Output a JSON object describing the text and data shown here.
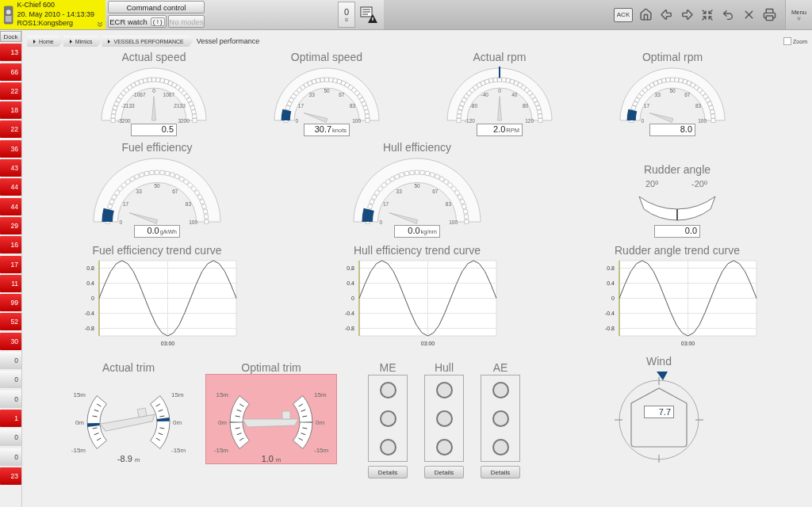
{
  "header": {
    "title": "K-Chief 600",
    "datetime": "20. May 2010 - 14:13:39",
    "location": "ROS1:Kongsberg"
  },
  "command_button": {
    "label": "Command control"
  },
  "watch_button": {
    "label": "ECR watch",
    "badge": "( ! )"
  },
  "modes_button": {
    "label": "No modes",
    "disabled": true
  },
  "alarm_counter": "0",
  "toolbar": {
    "ack": "ACK",
    "menu": "Menu"
  },
  "dock": {
    "label": "Dock",
    "items": [
      {
        "count": "13",
        "alarm": true
      },
      {
        "count": "66",
        "alarm": true
      },
      {
        "count": "22",
        "alarm": true
      },
      {
        "count": "18",
        "alarm": true
      },
      {
        "count": "22",
        "alarm": true
      },
      {
        "count": "36",
        "alarm": true
      },
      {
        "count": "43",
        "alarm": true
      },
      {
        "count": "44",
        "alarm": true
      },
      {
        "count": "44",
        "alarm": true
      },
      {
        "count": "29",
        "alarm": true
      },
      {
        "count": "16",
        "alarm": true
      },
      {
        "count": "17",
        "alarm": true
      },
      {
        "count": "11",
        "alarm": true
      },
      {
        "count": "99",
        "alarm": true
      },
      {
        "count": "52",
        "alarm": true
      },
      {
        "count": "30",
        "alarm": true
      },
      {
        "count": "0",
        "alarm": false
      },
      {
        "count": "0",
        "alarm": false
      },
      {
        "count": "0",
        "alarm": false
      },
      {
        "count": "1",
        "alarm": true
      },
      {
        "count": "0",
        "alarm": false
      },
      {
        "count": "0",
        "alarm": false
      },
      {
        "count": "23",
        "alarm": true
      }
    ]
  },
  "breadcrumbs": [
    "Home",
    "Mimics",
    "VESSELS PERFORMANCE"
  ],
  "page_title": "Vessel performance",
  "zoom": {
    "label": "Zoom",
    "checked": false
  },
  "gauges": [
    {
      "title": "Actual speed",
      "kind": "plain",
      "scale": [
        "-3200",
        "-2133",
        "-1067",
        "0",
        "1067",
        "2133",
        "3200"
      ],
      "value": "0.5"
    },
    {
      "title": "Optimal speed",
      "kind": "low-band",
      "scale": [
        "0",
        "17",
        "33",
        "50",
        "67",
        "83",
        "100"
      ],
      "value": "30.7",
      "unit": "knots"
    },
    {
      "title": "Actual rpm",
      "kind": "top-mark",
      "scale": [
        "-120",
        "-80",
        "-40",
        "0",
        "40",
        "80",
        "120"
      ],
      "value": "2.0",
      "unit": "RPM"
    },
    {
      "title": "Optimal rpm",
      "kind": "low-band",
      "scale": [
        "0",
        "17",
        "33",
        "50",
        "67",
        "83",
        "100"
      ],
      "value": "8.0"
    }
  ],
  "efficiency_gauges": [
    {
      "title": "Fuel efficiency",
      "kind": "low-band",
      "scale": [
        "0",
        "17",
        "33",
        "50",
        "67",
        "83",
        "100"
      ],
      "value": "0.0",
      "unit": "g/kWh"
    },
    {
      "title": "Hull efficiency",
      "kind": "low-band",
      "scale": [
        "0",
        "17",
        "33",
        "50",
        "67",
        "83",
        "100"
      ],
      "value": "0.0",
      "unit": "kg/nm"
    }
  ],
  "rudder": {
    "title": "Rudder angle",
    "port": "20º",
    "starboard": "-20º",
    "value": "0.0",
    "level": 0.5
  },
  "trends": [
    {
      "title": "Fuel efficiency trend curve",
      "time_label": "03:00",
      "chart_data": {
        "type": "line",
        "grid": true,
        "series": [
          {
            "color": "#555555",
            "values": [
              0,
              0.38,
              0.71,
              0.92,
              1,
              0.92,
              0.71,
              0.38,
              0,
              -0.38,
              -0.71,
              -0.92,
              -1,
              -0.92,
              -0.71,
              -0.38,
              0,
              0.38,
              0.71,
              0.92,
              1,
              0.92,
              0.71,
              0.38,
              0
            ]
          }
        ],
        "ylim": [
          -1,
          1
        ],
        "yticks": [
          0.8,
          0.4,
          0,
          -0.4,
          -0.8
        ]
      }
    },
    {
      "title": "Hull efficiency trend curve",
      "time_label": "03:00",
      "chart_data": {
        "type": "line",
        "grid": true,
        "series": [
          {
            "color": "#555555",
            "values": [
              0,
              0.38,
              0.71,
              0.92,
              1,
              0.92,
              0.71,
              0.38,
              0,
              -0.38,
              -0.71,
              -0.92,
              -1,
              -0.92,
              -0.71,
              -0.38,
              0,
              0.38,
              0.71,
              0.92,
              1,
              0.92,
              0.71,
              0.38,
              0
            ]
          }
        ],
        "ylim": [
          -1,
          1
        ],
        "yticks": [
          0.8,
          0.4,
          0,
          -0.4,
          -0.8
        ]
      }
    },
    {
      "title": "Rudder angle trend curve",
      "time_label": "03:00",
      "chart_data": {
        "type": "line",
        "grid": true,
        "series": [
          {
            "color": "#555555",
            "values": [
              0,
              0.38,
              0.71,
              0.92,
              1,
              0.92,
              0.71,
              0.38,
              0,
              -0.38,
              -0.71,
              -0.92,
              -1,
              -0.92,
              -0.71,
              -0.38,
              0,
              0.38,
              0.71,
              0.92,
              1,
              0.92,
              0.71,
              0.38,
              0
            ]
          }
        ],
        "ylim": [
          -1,
          1
        ],
        "yticks": [
          0.8,
          0.4,
          0,
          -0.4,
          -0.8
        ]
      }
    }
  ],
  "trims": [
    {
      "title": "Actual trim",
      "scale_left": [
        "15m",
        "0m",
        "-15m"
      ],
      "scale_right": [
        "15m",
        "0m",
        "-15m"
      ],
      "value": "-8.9",
      "unit": "m",
      "kind": "band",
      "alarm": false
    },
    {
      "title": "Optimal trim",
      "scale_left": [
        "15m",
        "0m",
        "-15m"
      ],
      "scale_right": [
        "15m",
        "0m",
        "-15m"
      ],
      "value": "1.0",
      "unit": "m",
      "kind": "line",
      "alarm": true
    }
  ],
  "status_panels": [
    {
      "title": "ME",
      "lamps": [
        {
          "on": false
        },
        {
          "on": false
        },
        {
          "on": false
        }
      ],
      "button": "Details"
    },
    {
      "title": "Hull",
      "lamps": [
        {
          "on": false
        },
        {
          "on": false
        },
        {
          "on": false
        }
      ],
      "button": "Details"
    },
    {
      "title": "AE",
      "lamps": [
        {
          "on": false
        },
        {
          "on": false
        },
        {
          "on": false
        }
      ],
      "button": "Details"
    }
  ],
  "wind": {
    "title": "Wind",
    "value": "7.7"
  }
}
